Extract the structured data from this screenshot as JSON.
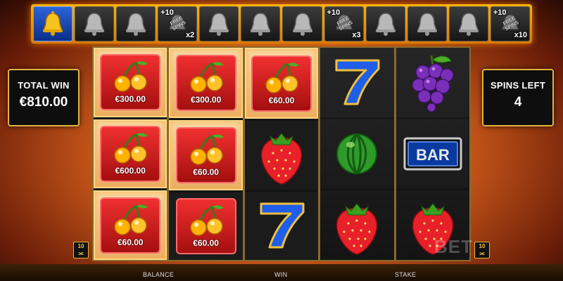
{
  "bell_bar": [
    {
      "state": "active",
      "icon": "gold-bell-icon"
    },
    {
      "state": "empty",
      "icon": "silver-bell-icon"
    },
    {
      "state": "empty",
      "icon": "silver-bell-icon"
    },
    {
      "state": "bonus",
      "plus": "+10",
      "free": "FREE SPINS",
      "mult": "x2"
    },
    {
      "state": "empty",
      "icon": "silver-bell-icon"
    },
    {
      "state": "empty",
      "icon": "silver-bell-icon"
    },
    {
      "state": "empty",
      "icon": "silver-bell-icon"
    },
    {
      "state": "bonus",
      "plus": "+10",
      "free": "FREE SPINS",
      "mult": "x3"
    },
    {
      "state": "empty",
      "icon": "silver-bell-icon"
    },
    {
      "state": "empty",
      "icon": "silver-bell-icon"
    },
    {
      "state": "empty",
      "icon": "silver-bell-icon"
    },
    {
      "state": "bonus",
      "plus": "+10",
      "free": "FREE SPINS",
      "mult": "x10"
    }
  ],
  "total_win": {
    "label": "TOTAL WIN",
    "value": "€810.00"
  },
  "spins_left": {
    "label": "SPINS LEFT",
    "value": "4"
  },
  "reels": [
    [
      {
        "symbol": "cherry",
        "prize": "€300.00"
      },
      {
        "symbol": "cherry",
        "prize": "€600.00"
      },
      {
        "symbol": "cherry",
        "prize": "€60.00"
      }
    ],
    [
      {
        "symbol": "cherry",
        "prize": "€300.00"
      },
      {
        "symbol": "cherry",
        "prize": "€60.00"
      },
      {
        "symbol": "cherry",
        "prize": "€60.00"
      }
    ],
    [
      {
        "symbol": "cherry",
        "prize": "€60.00"
      },
      {
        "symbol": "strawberry"
      },
      {
        "symbol": "seven"
      }
    ],
    [
      {
        "symbol": "seven"
      },
      {
        "symbol": "watermelon"
      },
      {
        "symbol": "strawberry"
      }
    ],
    [
      {
        "symbol": "grapes"
      },
      {
        "symbol": "bar",
        "text": "BAR"
      },
      {
        "symbol": "strawberry"
      }
    ]
  ],
  "bottom": {
    "balance_label": "BALANCE",
    "win_label": "WIN",
    "stake_label": "STAKE"
  },
  "lines_badge": {
    "value": "10"
  },
  "watermark": "BET"
}
